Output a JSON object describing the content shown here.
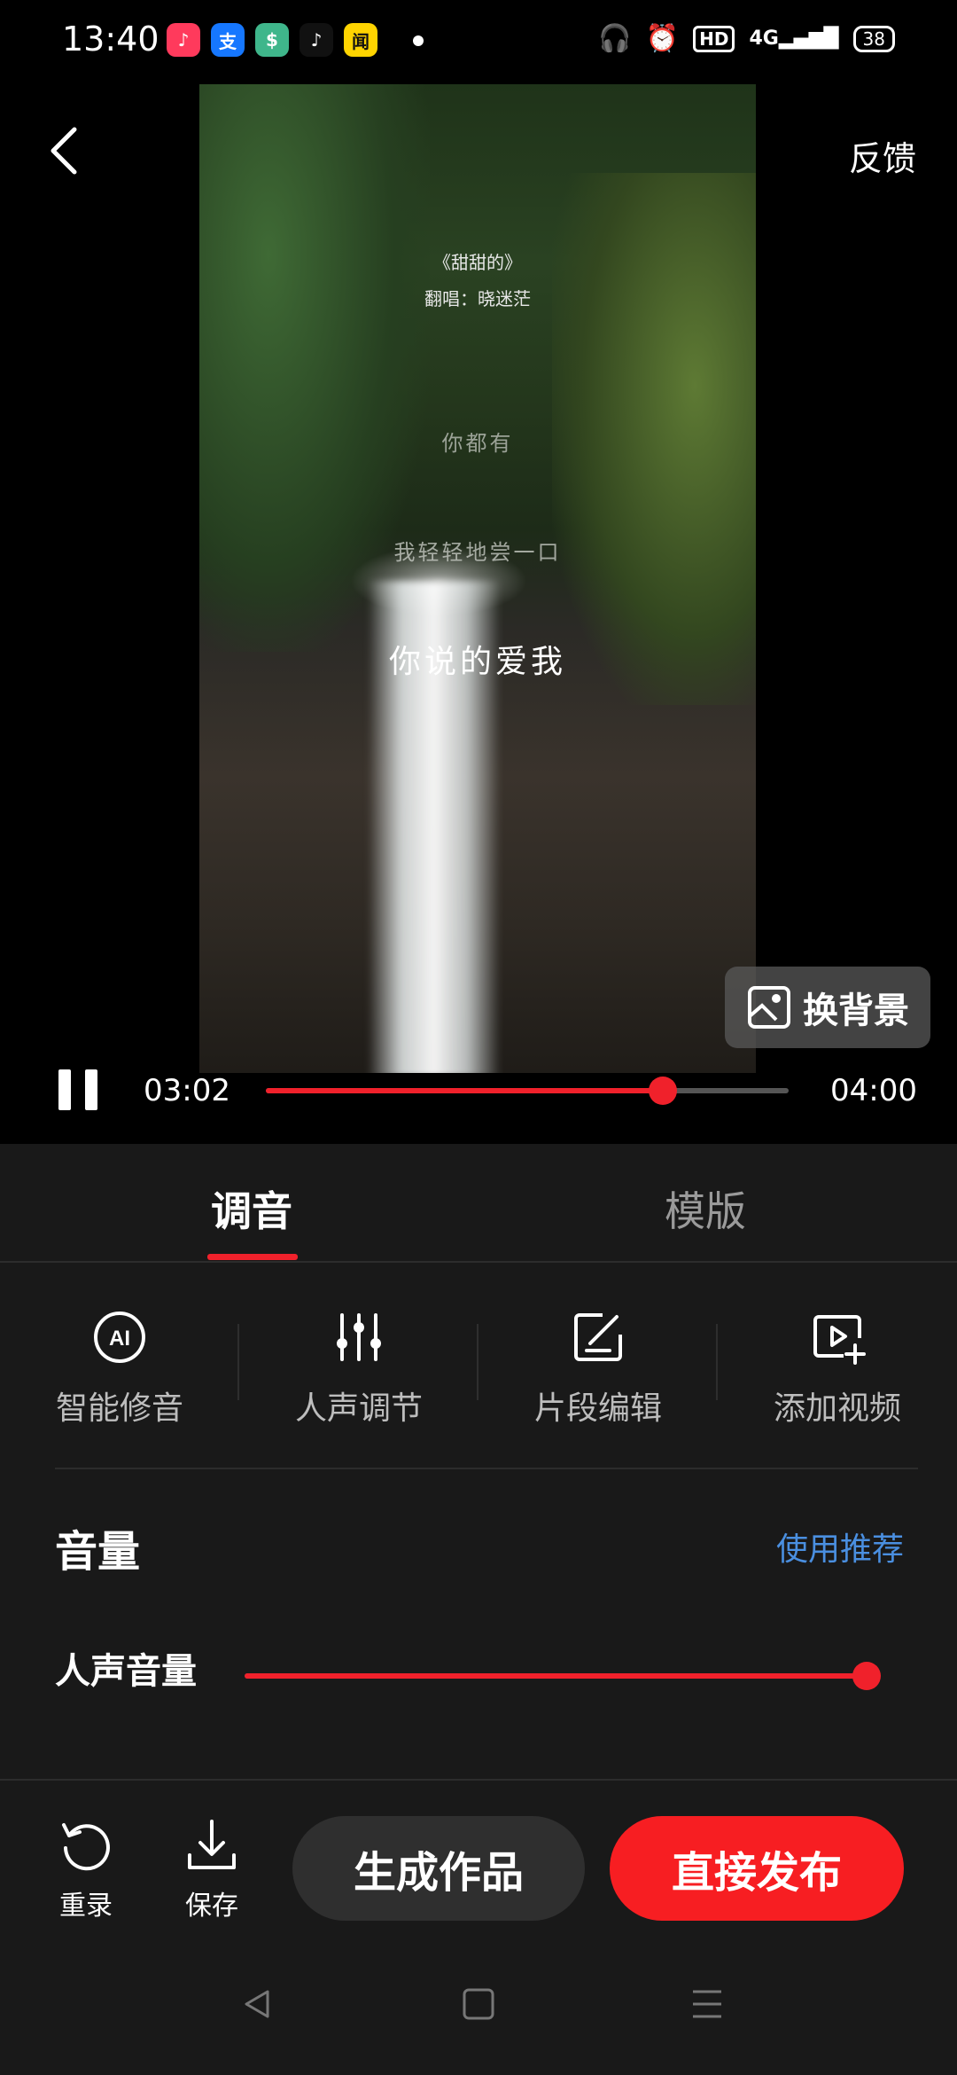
{
  "status_bar": {
    "time": "13:40",
    "app_icons": [
      {
        "name": "xiaohongshu-app-icon",
        "glyph": "♪",
        "color": "#ff3a5c"
      },
      {
        "name": "alipay-app-icon",
        "glyph": "支",
        "color": "#1677ff"
      },
      {
        "name": "wallet-app-icon",
        "glyph": "$",
        "color": "#3fb68b"
      },
      {
        "name": "tiktok-app-icon",
        "glyph": "♪",
        "color": "#111111"
      },
      {
        "name": "news-app-icon",
        "glyph": "闻",
        "color": "#ffd400"
      }
    ],
    "network": "4G",
    "hd": "HD",
    "battery": "38"
  },
  "header": {
    "feedback": "反馈"
  },
  "video": {
    "song_title": "《甜甜的》",
    "singer": "翻唱：晓迷茫",
    "lyric_1": "你都有",
    "lyric_2": "我轻轻地尝一口",
    "lyric_3": "你说的爱我",
    "change_background": "换背景"
  },
  "player": {
    "current_time": "03:02",
    "total_time": "04:00",
    "progress": 0.76
  },
  "tabs": [
    {
      "label": "调音",
      "active": true
    },
    {
      "label": "模版",
      "active": false
    }
  ],
  "tools": [
    {
      "label": "智能修音",
      "icon": "ai-icon"
    },
    {
      "label": "人声调节",
      "icon": "sliders-icon"
    },
    {
      "label": "片段编辑",
      "icon": "edit-icon"
    },
    {
      "label": "添加视频",
      "icon": "add-video-icon"
    }
  ],
  "volume": {
    "title": "音量",
    "use_recommended": "使用推荐",
    "vocal_label": "人声音量",
    "vocal_level": 0.98
  },
  "actions": {
    "rerecord": "重录",
    "save": "保存",
    "generate": "生成作品",
    "publish": "直接发布"
  },
  "colors": {
    "accent": "#f0212b",
    "link": "#4a8fe0",
    "panel": "#191919"
  }
}
